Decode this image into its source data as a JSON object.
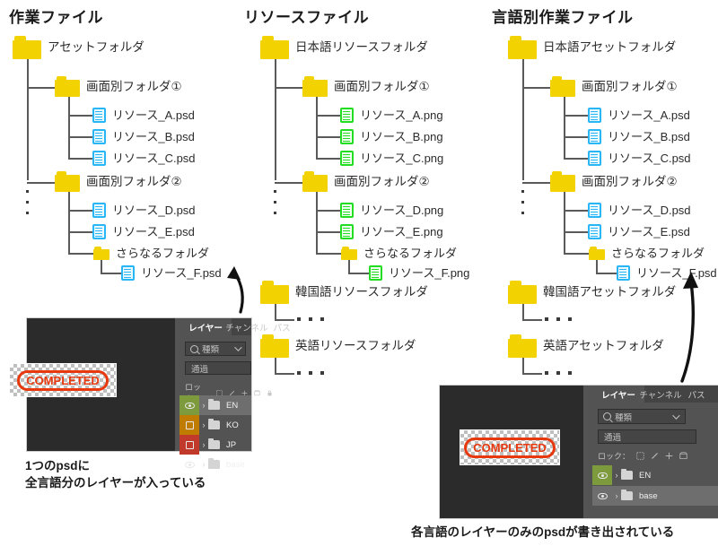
{
  "columns": [
    {
      "id": "work-files",
      "title": "作業ファイル",
      "root": "アセットフォルダ",
      "groups": [
        {
          "folder": "画面別フォルダ①",
          "files": [
            "リソース_A.psd",
            "リソース_B.psd",
            "リソース_C.psd"
          ]
        },
        {
          "folder": "画面別フォルダ②",
          "files": [
            "リソース_D.psd",
            "リソース_E.psd"
          ],
          "subfolder": "さらなるフォルダ",
          "subfiles": [
            "リソース_F.psd"
          ]
        }
      ],
      "file_icon_color": "#29b6f6",
      "extra_roots": []
    },
    {
      "id": "resource-files",
      "title": "リソースファイル",
      "root": "日本語リソースフォルダ",
      "groups": [
        {
          "folder": "画面別フォルダ①",
          "files": [
            "リソース_A.png",
            "リソース_B.png",
            "リソース_C.png"
          ]
        },
        {
          "folder": "画面別フォルダ②",
          "files": [
            "リソース_D.png",
            "リソース_E.png"
          ],
          "subfolder": "さらなるフォルダ",
          "subfiles": [
            "リソース_F.png"
          ]
        }
      ],
      "file_icon_color": "#22dd22",
      "extra_roots": [
        "韓国語リソースフォルダ",
        "英語リソースフォルダ"
      ]
    },
    {
      "id": "per-language-work-files",
      "title": "言語別作業ファイル",
      "root": "日本語アセットフォルダ",
      "groups": [
        {
          "folder": "画面別フォルダ①",
          "files": [
            "リソース_A.psd",
            "リソース_B.psd",
            "リソース_C.psd"
          ]
        },
        {
          "folder": "画面別フォルダ②",
          "files": [
            "リソース_D.psd",
            "リソース_E.psd"
          ],
          "subfolder": "さらなるフォルダ",
          "subfiles": [
            "リソース_F.psd"
          ]
        }
      ],
      "file_icon_color": "#29b6f6",
      "extra_roots": [
        "韓国語アセットフォルダ",
        "英語アセットフォルダ"
      ]
    }
  ],
  "ellipsis": "・・・",
  "photoshop_left": {
    "stamp_text": "COMPLETED",
    "tabs": [
      {
        "label": "レイヤー",
        "active": true
      },
      {
        "label": "チャンネル",
        "active": false
      },
      {
        "label": "パス",
        "active": false
      }
    ],
    "search_value": "種類",
    "blend_mode": "通過",
    "lock_label": "ロック：",
    "layers": [
      {
        "name": "EN",
        "visible": true,
        "swatch": "#7d9a3c",
        "selected": true
      },
      {
        "name": "KO",
        "visible": false,
        "swatch": "#c07c00",
        "selected": false
      },
      {
        "name": "JP",
        "visible": false,
        "swatch": "#c0392b",
        "selected": false
      },
      {
        "name": "base",
        "visible": true,
        "swatch": "",
        "selected": false
      }
    ]
  },
  "photoshop_right": {
    "stamp_text": "COMPLETED",
    "tabs": [
      {
        "label": "レイヤー",
        "active": true
      },
      {
        "label": "チャンネル",
        "active": false
      },
      {
        "label": "パス",
        "active": false
      }
    ],
    "search_value": "種類",
    "blend_mode": "通過",
    "lock_label": "ロック：",
    "layers": [
      {
        "name": "EN",
        "visible": true,
        "swatch": "#7d9a3c",
        "selected": false
      },
      {
        "name": "base",
        "visible": true,
        "swatch": "",
        "selected": true
      }
    ]
  },
  "captions": {
    "left": "1つのpsdに\n全言語分のレイヤーが入っている",
    "right": "各言語のレイヤーのみのpsdが書き出されている"
  },
  "colors": {
    "folder": "#f2d200",
    "line": "#5a5a5a",
    "psd_file": "#29b6f6",
    "png_file": "#22dd22",
    "stamp": "#e8380d",
    "panel_bg": "#535353"
  }
}
